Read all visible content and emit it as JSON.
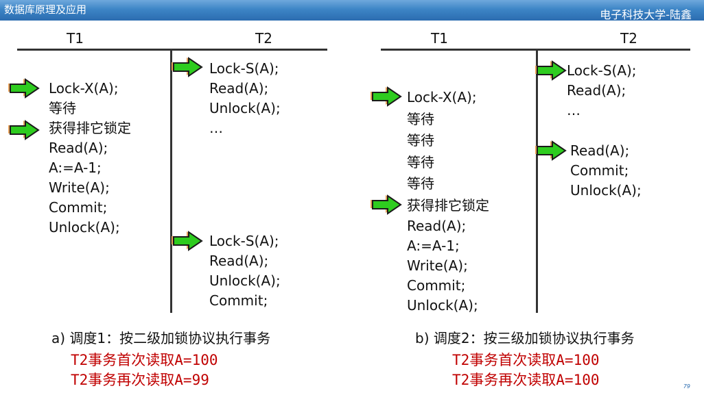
{
  "header": {
    "course_title": "数据库原理及应用",
    "author": "电子科技大学-陆鑫"
  },
  "left": {
    "t1_header": "T1",
    "t2_header": "T2",
    "t1_lines": [
      "Lock-X(A);",
      "等待",
      "获得排它锁定",
      "Read(A);",
      "A:=A-1;",
      "Write(A);",
      "Commit;",
      "Unlock(A);"
    ],
    "t2_top_lines": [
      "Lock-S(A);",
      "Read(A);",
      "Unlock(A);",
      "…"
    ],
    "t2_bottom_lines": [
      "Lock-S(A);",
      "Read(A);",
      "Unlock(A);",
      "Commit;"
    ],
    "caption": "a) 调度1：按二级加锁协议执行事务",
    "results": [
      "T2事务首次读取A=100",
      "T2事务再次读取A=99"
    ]
  },
  "right": {
    "t1_header": "T1",
    "t2_header": "T2",
    "t1_lines": [
      "Lock-X(A);",
      "等待",
      "等待",
      "等待",
      "等待",
      "获得排它锁定",
      "Read(A);",
      "A:=A-1;",
      "Write(A);",
      "Commit;",
      "Unlock(A);"
    ],
    "t2_top_lines": [
      "Lock-S(A);",
      "Read(A);",
      "…"
    ],
    "t2_bottom_lines": [
      "Read(A);",
      "Commit;",
      "Unlock(A);"
    ],
    "caption": "b) 调度2：按三级加锁协议执行事务",
    "results": [
      "T2事务首次读取A=100",
      "T2事务再次读取A=100"
    ]
  },
  "page_number": "79",
  "colors": {
    "arrow_fill": "#2ecc1f",
    "arrow_stroke": "#1a1a1a",
    "arrow_shadow": "#e8a25a",
    "result_text": "#c00000",
    "header_bar": "#3d85c6"
  }
}
